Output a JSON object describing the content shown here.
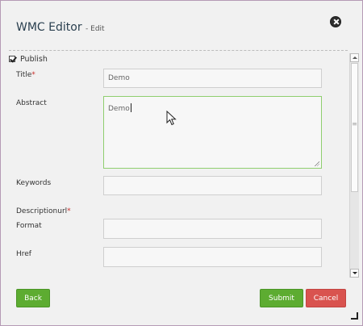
{
  "dialog": {
    "title": "WMC Editor",
    "subtitle": "- Edit",
    "close_icon": "close-circle-icon"
  },
  "form": {
    "publish": {
      "label": "Publish",
      "checked": true
    },
    "title": {
      "label": "Title",
      "required_mark": "*",
      "value": "Demo"
    },
    "abstract": {
      "label": "Abstract",
      "value": "Demo"
    },
    "keywords": {
      "label": "Keywords",
      "value": ""
    },
    "descriptionurl": {
      "label": "Descriptionurl",
      "required_mark": "*"
    },
    "format": {
      "label": "Format",
      "value": ""
    },
    "href": {
      "label": "Href",
      "value": ""
    }
  },
  "buttons": {
    "back": "Back",
    "submit": "Submit",
    "cancel": "Cancel"
  },
  "colors": {
    "accent_green": "#5dac31",
    "danger_red": "#d9534f",
    "focus_border": "#8fce6f"
  }
}
